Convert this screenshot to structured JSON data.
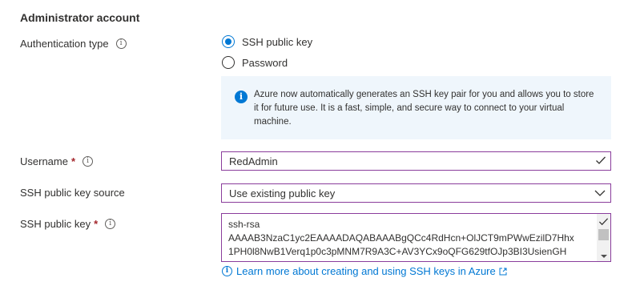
{
  "section": {
    "title": "Administrator account"
  },
  "auth": {
    "label": "Authentication type",
    "options": [
      {
        "label": "SSH public key",
        "checked": true
      },
      {
        "label": "Password",
        "checked": false
      }
    ],
    "info_text": "Azure now automatically generates an SSH key pair for you and allows you to store it for future use. It is a fast, simple, and secure way to connect to your virtual machine."
  },
  "username": {
    "label": "Username",
    "required_mark": "*",
    "value": "RedAdmin"
  },
  "key_source": {
    "label": "SSH public key source",
    "value": "Use existing public key"
  },
  "public_key": {
    "label": "SSH public key",
    "required_mark": "*",
    "lines": [
      "ssh-rsa",
      "AAAAB3NzaC1yc2EAAAADAQABAAABgQCc4RdHcn+OlJCT9mPWwEzilD7Hhx",
      "1PH0l8NwB1Verq1p0c3pMNM7R9A3C+AV3YCx9oQFG629tfOJp3BI3UsienGH"
    ]
  },
  "learn_more": {
    "text": "Learn more about creating and using SSH keys in Azure"
  },
  "colors": {
    "accent": "#0078d4",
    "field_border": "#8a3d9c",
    "info_bg": "#eff6fc",
    "required": "#a4262c"
  },
  "icons": [
    "info-icon",
    "radio-icon",
    "checkmark-icon",
    "chevron-down-icon",
    "external-link-icon"
  ]
}
